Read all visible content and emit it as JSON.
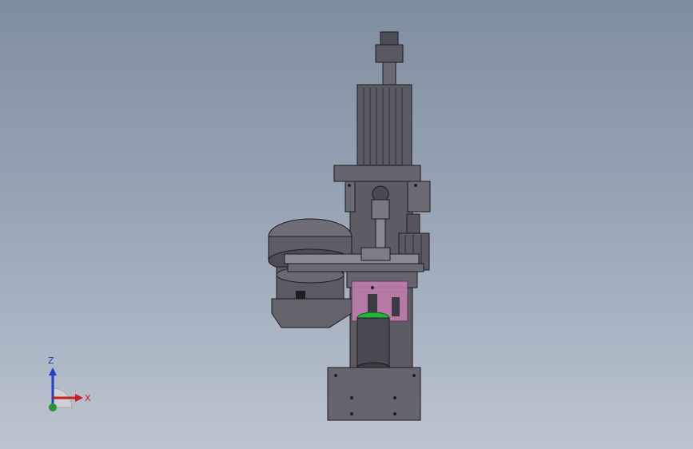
{
  "viewport": {
    "background_top": "#7f8da0",
    "background_bottom": "#bcc4cf"
  },
  "triad": {
    "z_label": "Z",
    "x_label": "X",
    "z_color": "#1f3fc8",
    "x_color": "#c81f1f",
    "y_color": "#1f9a2f"
  },
  "model": {
    "body_color": "#5f5e66",
    "highlight_color": "#c47fb0",
    "accent_ring_color": "#23b53a"
  }
}
